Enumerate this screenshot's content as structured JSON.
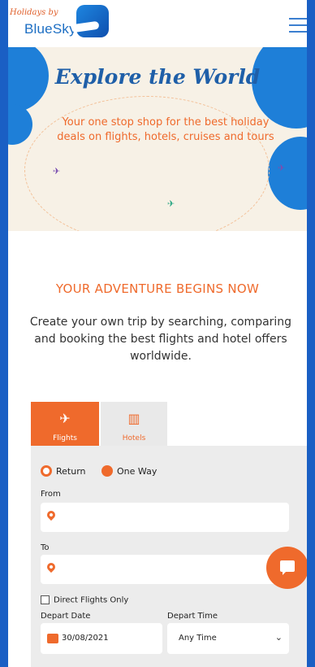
{
  "header": {
    "logo_tagline": "Holidays by",
    "logo_name": "BlueSky",
    "menu_icon": "hamburger-icon"
  },
  "hero": {
    "title": "Explore the World",
    "subtitle": "Your one stop shop for the best holiday deals on flights, hotels, cruises and tours"
  },
  "intro": {
    "heading": "YOUR ADVENTURE BEGINS NOW",
    "text": "Create your own trip by searching, comparing and booking the best flights and hotel offers worldwide."
  },
  "search": {
    "tabs": [
      {
        "label": "Flights",
        "icon": "plane-icon",
        "active": true
      },
      {
        "label": "Hotels",
        "icon": "hotel-icon",
        "active": false
      }
    ],
    "trip_types": [
      {
        "label": "Return",
        "selected": true
      },
      {
        "label": "One Way",
        "selected": false
      }
    ],
    "from_label": "From",
    "to_label": "To",
    "direct_label": "Direct Flights Only",
    "depart_date_label": "Depart Date",
    "depart_time_label": "Depart Time",
    "depart_date_value": "30/08/2021",
    "depart_time_value": "Any Time"
  },
  "colors": {
    "accent": "#ef6a2c",
    "brand": "#1c6ec3",
    "background": "#1a5fc4"
  }
}
